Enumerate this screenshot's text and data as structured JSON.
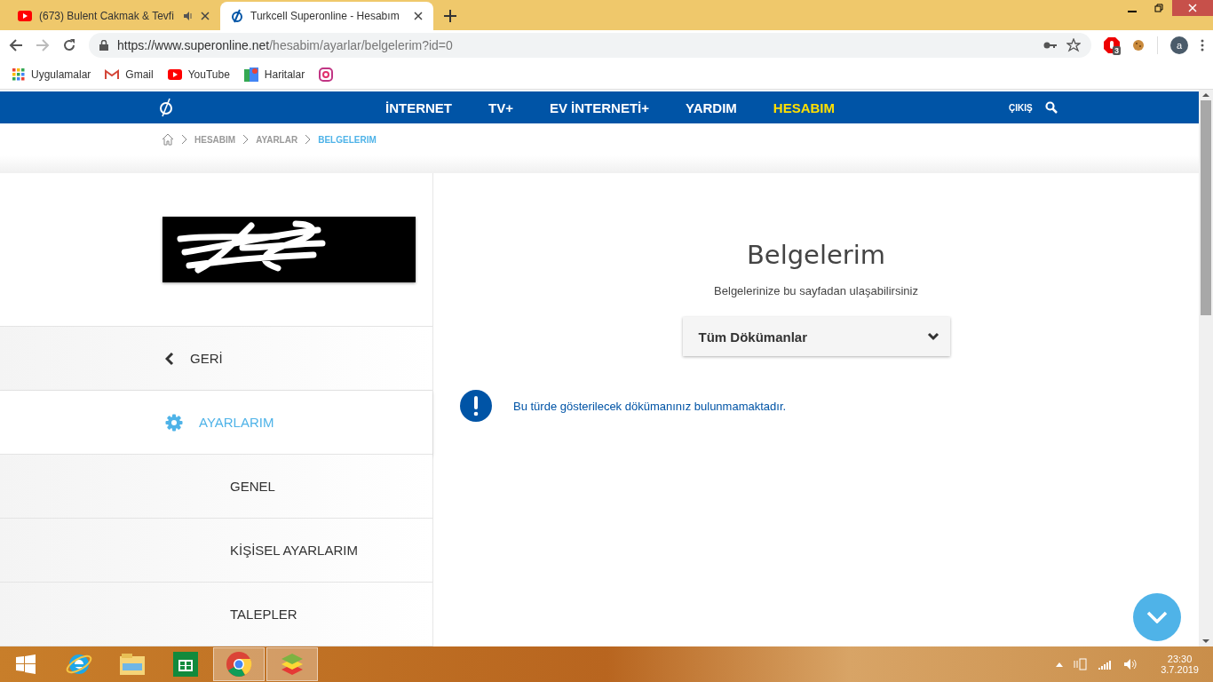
{
  "browser": {
    "tabs": [
      {
        "title": "(673) Bulent Cakmak & Tevfi",
        "kind": "youtube",
        "audio": true,
        "selected": false
      },
      {
        "title": "Turkcell Superonline - Hesabım",
        "kind": "site",
        "audio": false,
        "selected": true
      }
    ],
    "url": {
      "host": "https://www.superonline.net",
      "path": "/hesabim/ayarlar/belgelerim?id=0"
    },
    "extension_badge": "3",
    "profile": "a",
    "bookmarks": [
      {
        "label": "Uygulamalar",
        "kind": "apps"
      },
      {
        "label": "Gmail",
        "kind": "gmail"
      },
      {
        "label": "YouTube",
        "kind": "youtube"
      },
      {
        "label": "Haritalar",
        "kind": "maps"
      },
      {
        "kind": "instagram"
      }
    ]
  },
  "nav": {
    "items": [
      {
        "label": "İNTERNET",
        "selected": false
      },
      {
        "label": "TV+",
        "selected": false
      },
      {
        "label": "EV İNTERNETİ+",
        "selected": false
      },
      {
        "label": "YARDIM",
        "selected": false
      },
      {
        "label": "HESABIM",
        "selected": true
      }
    ],
    "logout": "ÇIKIŞ"
  },
  "breadcrumb": [
    {
      "label": "HESABIM",
      "selected": false
    },
    {
      "label": "AYARLAR",
      "selected": false
    },
    {
      "label": "BELGELERIM",
      "selected": true
    }
  ],
  "sidebar": {
    "items": [
      {
        "label": "GERİ",
        "kind": "back",
        "selected": false
      },
      {
        "label": "AYARLARIM",
        "kind": "section",
        "selected": true
      },
      {
        "label": "GENEL",
        "kind": "sub",
        "selected": false
      },
      {
        "label": "KİŞİSEL AYARLARIM",
        "kind": "sub",
        "selected": false
      },
      {
        "label": "TALEPLER",
        "kind": "sub",
        "selected": false
      }
    ]
  },
  "main": {
    "title": "Belgelerim",
    "subtitle": "Belgelerinize bu sayfadan ulaşabilirsiniz",
    "dropdown": {
      "value": "Tüm Dökümanlar"
    },
    "message": "Bu türde gösterilecek dökümanınız bulunmamaktadır."
  },
  "taskbar": {
    "apps": [
      {
        "kind": "ie",
        "selected": false
      },
      {
        "kind": "explorer",
        "selected": false
      },
      {
        "kind": "store",
        "selected": false
      },
      {
        "kind": "chrome",
        "selected": true
      },
      {
        "kind": "bluestacks",
        "selected": true
      }
    ],
    "time": "23:30",
    "date": "3.7.2019"
  }
}
